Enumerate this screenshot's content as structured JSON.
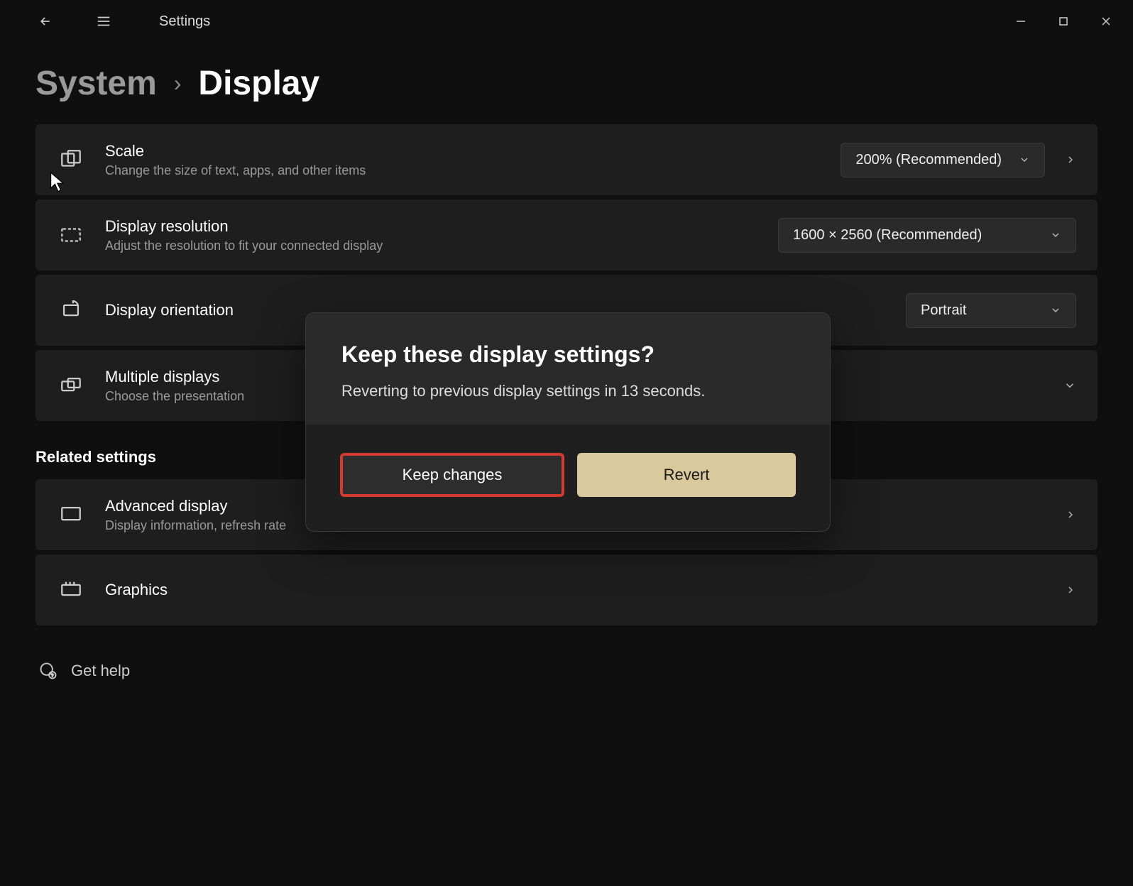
{
  "titlebar": {
    "app_name": "Settings"
  },
  "breadcrumb": {
    "parent": "System",
    "sep": "›",
    "current": "Display"
  },
  "cards": {
    "scale": {
      "title": "Scale",
      "desc": "Change the size of text, apps, and other items",
      "value": "200% (Recommended)"
    },
    "resolution": {
      "title": "Display resolution",
      "desc": "Adjust the resolution to fit your connected display",
      "value": "1600 × 2560 (Recommended)"
    },
    "orientation": {
      "title": "Display orientation",
      "value": "Portrait"
    },
    "multiple": {
      "title": "Multiple displays",
      "desc": "Choose the presentation"
    }
  },
  "related_label": "Related settings",
  "related": {
    "advanced": {
      "title": "Advanced display",
      "desc": "Display information, refresh rate"
    },
    "graphics": {
      "title": "Graphics"
    }
  },
  "help": {
    "label": "Get help"
  },
  "dialog": {
    "title": "Keep these display settings?",
    "msg": "Reverting to previous display settings in 13 seconds.",
    "keep": "Keep changes",
    "revert": "Revert"
  }
}
